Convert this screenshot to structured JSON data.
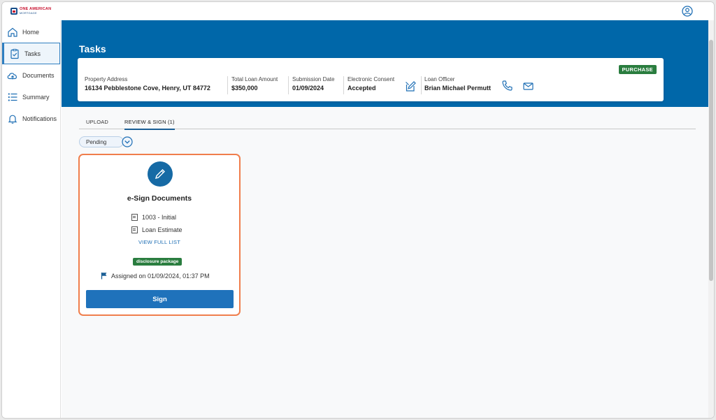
{
  "app": {
    "logo_text": "ONE AMERICAN",
    "logo_subtext": "MORTGAGE"
  },
  "sidebar": {
    "items": [
      {
        "label": "Home",
        "icon": "home-icon"
      },
      {
        "label": "Tasks",
        "icon": "clipboard-check-icon",
        "active": true
      },
      {
        "label": "Documents",
        "icon": "cloud-upload-icon"
      },
      {
        "label": "Summary",
        "icon": "list-icon"
      },
      {
        "label": "Notifications",
        "icon": "bell-icon"
      }
    ]
  },
  "header": {
    "title": "Tasks"
  },
  "loan": {
    "badge": "PURCHASE",
    "property_address_label": "Property Address",
    "property_address": "16134 Pebblestone Cove, Henry, UT 84772",
    "loan_amount_label": "Total Loan Amount",
    "loan_amount": "$350,000",
    "submission_date_label": "Submission Date",
    "submission_date": "01/09/2024",
    "consent_label": "Electronic Consent",
    "consent_value": "Accepted",
    "officer_label": "Loan Officer",
    "officer_name": "Brian Michael Permutt"
  },
  "tabs": [
    {
      "label": "UPLOAD"
    },
    {
      "label": "REVIEW & SIGN (1)",
      "active": true
    }
  ],
  "filter": {
    "value": "Pending"
  },
  "task_card": {
    "title": "e-Sign Documents",
    "documents": [
      "1003 - Initial",
      "Loan Estimate"
    ],
    "view_link": "VIEW FULL LIST",
    "tag": "disclosure package",
    "assigned": "Assigned on 01/09/2024, 01:37 PM",
    "button_label": "Sign"
  },
  "colors": {
    "brand_blue": "#0067a9",
    "button_blue": "#1f72bb",
    "badge_green": "#2a7d3f",
    "card_highlight": "#f07e4c"
  }
}
